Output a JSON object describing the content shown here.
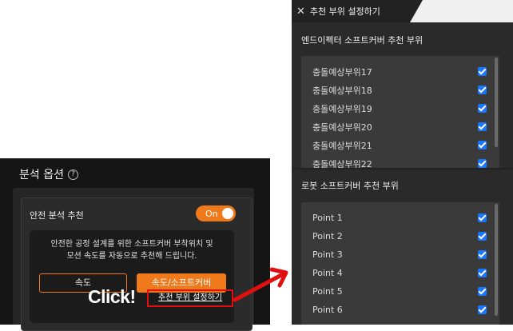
{
  "left_panel": {
    "title": "분석 옵션",
    "help_icon": "question-circle-icon",
    "section_label": "안전 분석 추천",
    "toggle_label": "On",
    "toggle_on": true,
    "description_line1": "안전한 공정 설계를 위한 소프트커버 부착위치 및",
    "description_line2": "모션 속도를 자동으로 추천해 드립니다.",
    "button_speed": "속도",
    "button_speed_softcover": "속도/소프트커버",
    "click_text": "Click!",
    "recommend_link": "추천 부위 설정하기"
  },
  "right_panel": {
    "tab_title": "추천 부위 설정하기",
    "close_icon": "close-icon",
    "section1_title": "엔드이펙터 소프트커버 추천 부위",
    "section1_items": [
      {
        "label": "충돌예상부위17",
        "checked": true
      },
      {
        "label": "충돌예상부위18",
        "checked": true
      },
      {
        "label": "충돌예상부위19",
        "checked": true
      },
      {
        "label": "충돌예상부위20",
        "checked": true
      },
      {
        "label": "충돌예상부위21",
        "checked": true
      },
      {
        "label": "충돌예상부위22",
        "checked": true
      }
    ],
    "section2_title": "로봇 소프트커버 추천 부위",
    "section2_items": [
      {
        "label": "Point 1",
        "checked": true
      },
      {
        "label": "Point 2",
        "checked": true
      },
      {
        "label": "Point 3",
        "checked": true
      },
      {
        "label": "Point 4",
        "checked": true
      },
      {
        "label": "Point 5",
        "checked": true
      },
      {
        "label": "Point 6",
        "checked": true
      }
    ]
  },
  "colors": {
    "accent": "#ef7a1c",
    "checkbox": "#1976ff",
    "highlight": "#e01010"
  }
}
